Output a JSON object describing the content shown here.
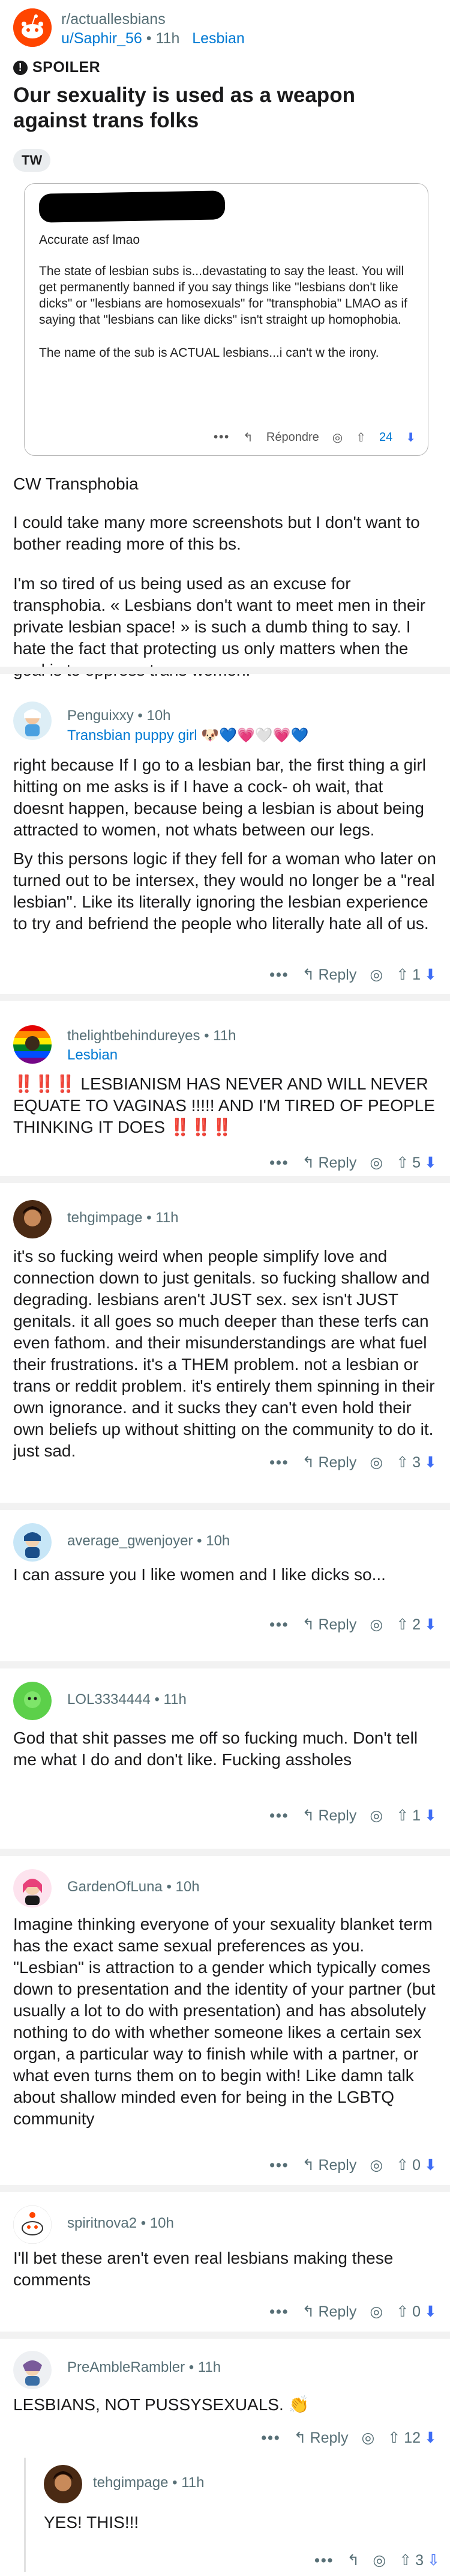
{
  "post": {
    "subreddit": "r/actuallesbians",
    "author": "u/Saphir_56",
    "time": "11h",
    "flair": "Lesbian",
    "spoiler_label": "SPOILER",
    "title": "Our sexuality is used as a weapon against trans folks",
    "tag": "TW",
    "screenshot": {
      "line1": "Accurate asf lmao",
      "para1": "The state of lesbian subs is...devastating to say the least. You will get permanently banned if you say things like \"lesbians don't like dicks\" or \"lesbians are homosexuals\" for \"transphobia\" LMAO as if saying that \"lesbians can like dicks\" isn't straight up homophobia.",
      "para2": "The name of the sub is ACTUAL lesbians...i can't w the irony.",
      "reply_label": "Répondre",
      "score": "24"
    },
    "cw": "CW Transphobia",
    "body1": "I could take many more screenshots but I don't want to bother reading more of this bs.",
    "body2": "I'm so tired of us being used as an excuse for transphobia. « Lesbians don't want to meet men in their private lesbian space! » is such a dumb thing to say. I hate the fact that protecting us only matters when the goal is to oppress trans women."
  },
  "labels": {
    "reply": "Reply",
    "more": "•••",
    "dot": "•"
  },
  "comments": [
    {
      "user": "Penguixxy",
      "time": "10h",
      "flair": "Transbian puppy girl 🐶💙💗🤍💗💙",
      "text": [
        "right because If I go to a lesbian bar, the first thing a girl hitting on me asks is if I have a cock- oh wait, that doesnt happen, because being a lesbian is about being attracted to women, not whats between our legs.",
        "By this persons logic if they fell for a woman who later on turned out to be intersex, they would no longer be a \"real lesbian\". Like its literally ignoring the lesbian experience to try and befriend the people who literally hate all of us."
      ],
      "score": "1"
    },
    {
      "user": "thelightbehindureyes",
      "time": "11h",
      "flair": "Lesbian",
      "text": [
        "‼️‼️‼️ LESBIANISM HAS NEVER AND WILL NEVER EQUATE TO VAGINAS !!!!! AND I'M TIRED OF PEOPLE THINKING IT DOES ‼️‼️‼️"
      ],
      "score": "5"
    },
    {
      "user": "tehgimpage",
      "time": "11h",
      "flair": "",
      "text": [
        "it's so fucking weird when people simplify love and connection down to just genitals.  so fucking shallow and degrading.  lesbians aren't JUST sex. sex isn't JUST genitals.  it all goes so much deeper than these terfs can even fathom.  and their misunderstandings are what fuel their frustrations.  it's a THEM problem.  not a lesbian or trans or reddit problem.  it's entirely them spinning in their own ignorance.  and it sucks they can't even hold their own beliefs up without shitting on the community to do it.  just sad."
      ],
      "score": "3"
    },
    {
      "user": "average_gwenjoyer",
      "time": "10h",
      "flair": "",
      "text": [
        "I can assure you I like women and I like dicks so..."
      ],
      "score": "2"
    },
    {
      "user": "LOL3334444",
      "time": "11h",
      "flair": "",
      "text": [
        "God that shit passes me off so fucking much. Don't tell me what I do and don't like. Fucking assholes"
      ],
      "score": "1"
    },
    {
      "user": "GardenOfLuna",
      "time": "10h",
      "flair": "",
      "text": [
        "Imagine thinking everyone of your sexuality blanket term has the exact same sexual preferences as you. \"Lesbian\" is attraction to a gender which typically comes down to presentation and the identity of your partner (but usually a lot to do with presentation) and has absolutely nothing to do with whether someone likes a certain sex organ, a particular way to finish while with a partner, or what even turns them on to begin with! Like damn talk about shallow minded even for being in the LGBTQ community"
      ],
      "score": "0"
    },
    {
      "user": "spiritnova2",
      "time": "10h",
      "flair": "",
      "text": [
        "I'll bet these aren't even real lesbians making these comments"
      ],
      "score": "0"
    },
    {
      "user": "PreAmbleRambler",
      "time": "11h",
      "flair": "",
      "text": [
        "LESBIANS, NOT PUSSYSEXUALS. 👏"
      ],
      "score": "12"
    }
  ],
  "nested_reply": {
    "user": "tehgimpage",
    "time": "11h",
    "text": "YES! THIS!!!",
    "score": "3"
  },
  "colors": {
    "accent": "#0079d3",
    "downvote": "#3f6df5",
    "meta": "#576f76"
  }
}
